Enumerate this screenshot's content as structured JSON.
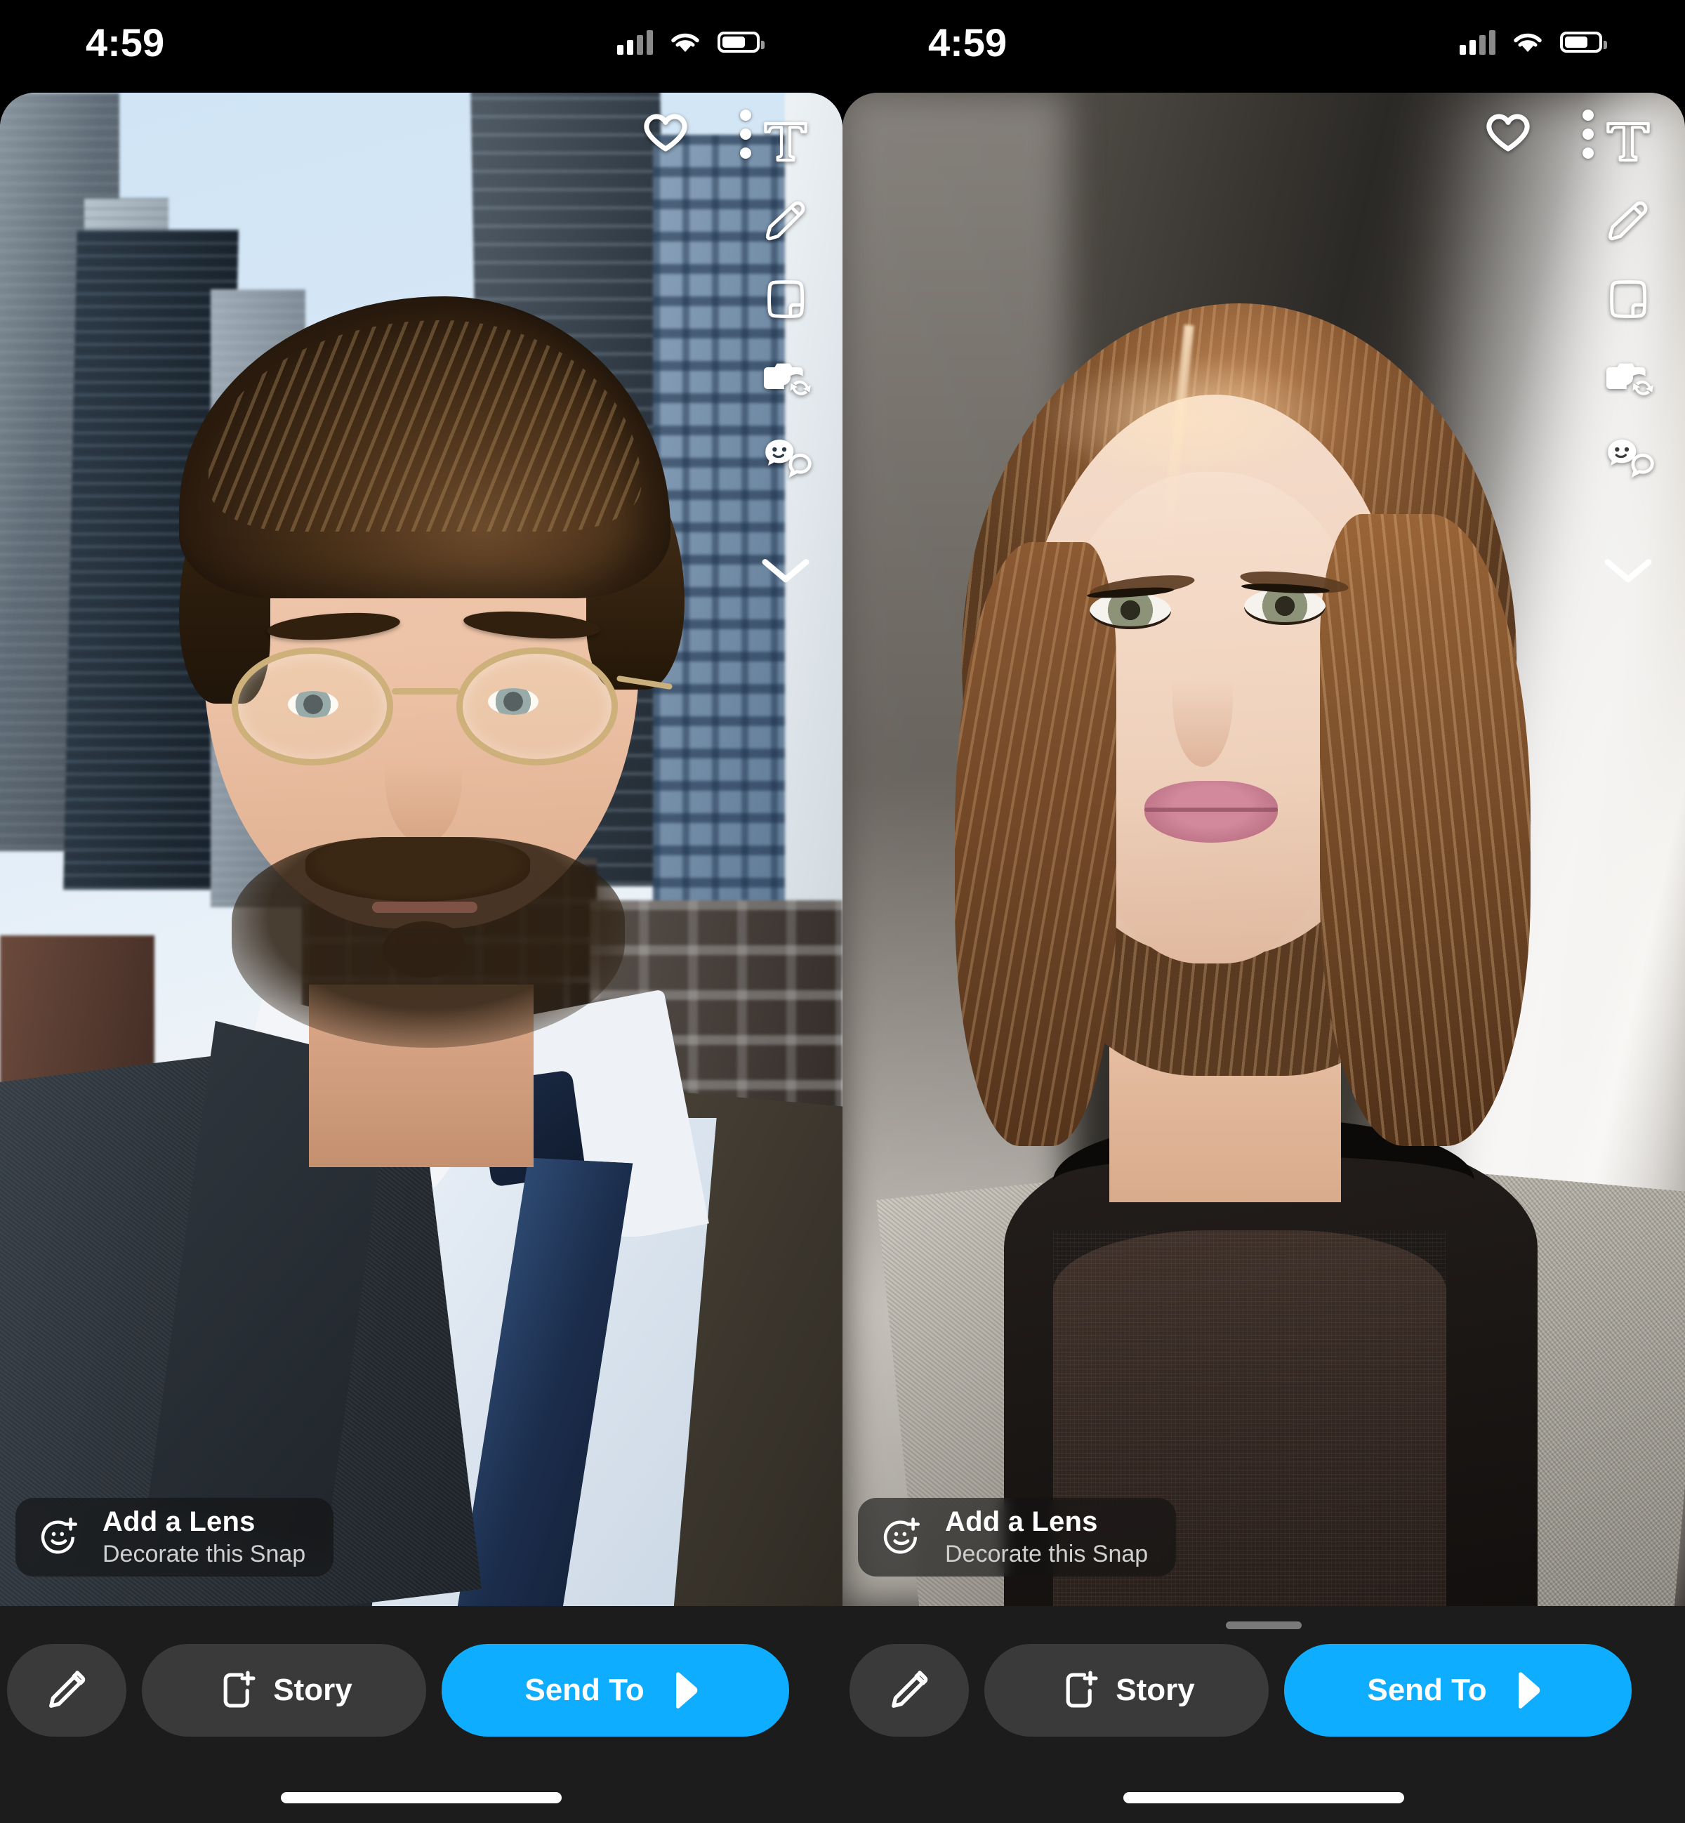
{
  "app": {
    "name": "Snapchat",
    "screen": "Snap Preview / Send To"
  },
  "panels": [
    {
      "id": "left",
      "status_bar": {
        "time": "4:59",
        "cellular_icon": "signal-bars-icon",
        "wifi_icon": "wifi-icon",
        "battery_icon": "battery-icon",
        "battery_level": "62"
      },
      "top_actions": {
        "favorite_icon": "heart-icon",
        "more_icon": "more-vertical-dots-icon"
      },
      "tools": [
        {
          "name": "text-tool",
          "icon": "text-t-icon",
          "label": "T"
        },
        {
          "name": "draw-tool",
          "icon": "pencil-icon",
          "label": ""
        },
        {
          "name": "sticker-tool",
          "icon": "sticker-icon",
          "label": ""
        },
        {
          "name": "cutout-tool",
          "icon": "camera-loop-icon",
          "label": ""
        },
        {
          "name": "bitmoji-tool",
          "icon": "emoji-cutout-icon",
          "label": ""
        },
        {
          "name": "collapse-tools",
          "icon": "chevron-down-icon",
          "label": ""
        }
      ],
      "lens_card": {
        "title": "Add a Lens",
        "subtitle": "Decorate this Snap",
        "icon": "add-lens-smiley-plus-icon"
      },
      "bottom_bar": {
        "edit_icon": "pencil-edit-icon",
        "story_label": "Story",
        "story_icon": "add-to-story-icon",
        "send_label": "Send To",
        "send_icon": "send-arrow-icon",
        "has_grabber": false
      },
      "photo": {
        "description": "Man in dark suit, white shirt, navy tie, glasses and mustache, city skyscrapers behind"
      }
    },
    {
      "id": "right",
      "status_bar": {
        "time": "4:59",
        "cellular_icon": "signal-bars-icon",
        "wifi_icon": "wifi-icon",
        "battery_icon": "battery-icon",
        "battery_level": "62"
      },
      "top_actions": {
        "favorite_icon": "heart-icon",
        "more_icon": "more-vertical-dots-icon"
      },
      "tools": [
        {
          "name": "text-tool",
          "icon": "text-t-icon",
          "label": "T"
        },
        {
          "name": "draw-tool",
          "icon": "pencil-icon",
          "label": ""
        },
        {
          "name": "sticker-tool",
          "icon": "sticker-icon",
          "label": ""
        },
        {
          "name": "cutout-tool",
          "icon": "camera-loop-icon",
          "label": ""
        },
        {
          "name": "bitmoji-tool",
          "icon": "emoji-cutout-icon",
          "label": ""
        },
        {
          "name": "collapse-tools",
          "icon": "chevron-down-icon",
          "label": ""
        }
      ],
      "lens_card": {
        "title": "Add a Lens",
        "subtitle": "Decorate this Snap",
        "icon": "add-lens-smiley-plus-icon"
      },
      "bottom_bar": {
        "edit_icon": "pencil-edit-icon",
        "story_label": "Story",
        "story_icon": "add-to-story-icon",
        "send_label": "Send To",
        "send_icon": "send-arrow-icon",
        "has_grabber": true
      },
      "photo": {
        "description": "Woman with short brown bob haircut, green eyes, black mesh top with grey jacket, bright studio background"
      }
    }
  ],
  "colors": {
    "accent_blue": "#0FADFF",
    "bar_background": "#1C1C1C",
    "button_grey": "#3A3A3A",
    "screen_black": "#000000",
    "text_white": "#FFFFFF",
    "text_muted": "#CFCFCF",
    "grabber_grey": "#7A7A7A"
  }
}
